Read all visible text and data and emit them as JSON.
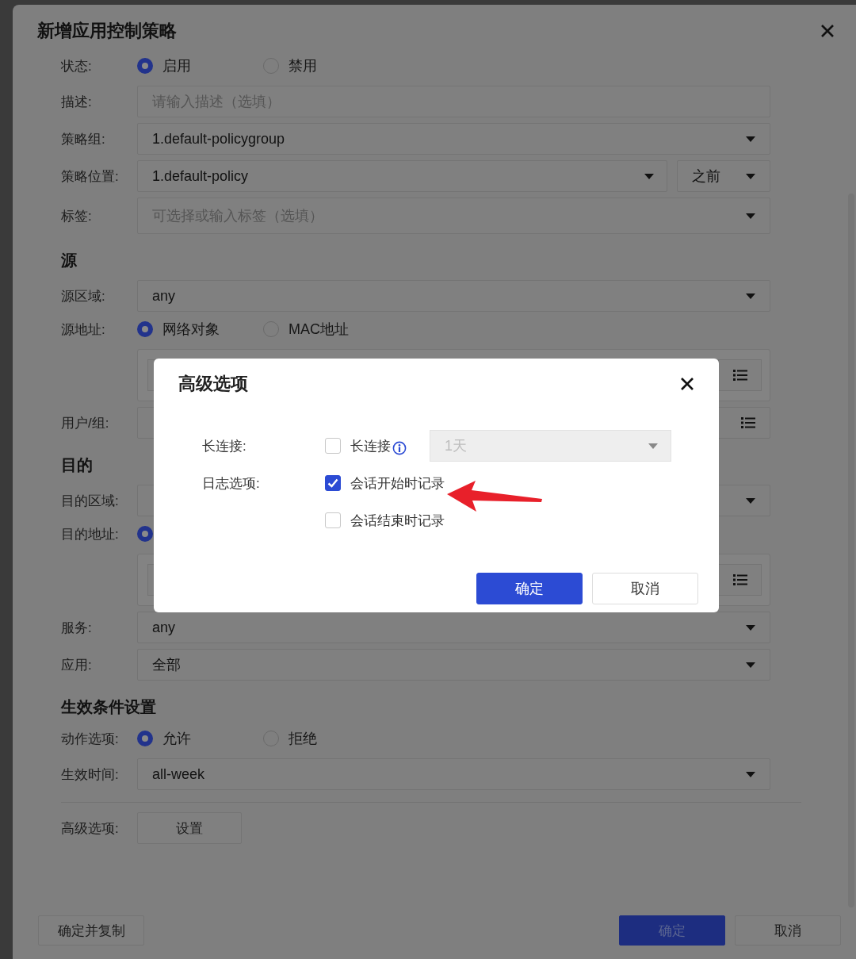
{
  "dialog": {
    "title": "新增应用控制策略",
    "rows": [
      {
        "kind": "radio",
        "label": "状态:",
        "options": [
          {
            "label": "启用",
            "selected": true
          },
          {
            "label": "禁用",
            "selected": false
          }
        ]
      },
      {
        "kind": "input",
        "label": "描述:",
        "placeholder": "请输入描述（选填）"
      },
      {
        "kind": "select",
        "label": "策略组:",
        "value": "1.default-policygroup"
      },
      {
        "kind": "select_pair",
        "label": "策略位置:",
        "value": "1.default-policy",
        "value_2": "之前"
      },
      {
        "kind": "select",
        "label": "标签:",
        "placeholder": "可选择或输入标签（选填）"
      },
      {
        "kind": "heading",
        "label": "源"
      },
      {
        "kind": "select",
        "label": "源区域:",
        "value": "any"
      },
      {
        "kind": "radio",
        "label": "源地址:",
        "options": [
          {
            "label": "网络对象",
            "selected": true
          },
          {
            "label": "MAC地址",
            "selected": false
          }
        ]
      },
      {
        "kind": "object_box"
      },
      {
        "kind": "picker",
        "label": "用户/组:"
      },
      {
        "kind": "heading",
        "label": "目的"
      },
      {
        "kind": "select",
        "label": "目的区域:"
      },
      {
        "kind": "radio",
        "label": "目的地址:",
        "options": [
          {
            "selected": true
          }
        ]
      },
      {
        "kind": "object_box"
      },
      {
        "kind": "select",
        "label": "服务:",
        "value": "any"
      },
      {
        "kind": "select",
        "label": "应用:",
        "value": "全部"
      },
      {
        "kind": "heading",
        "label": "生效条件设置"
      },
      {
        "kind": "radio",
        "label": "动作选项:",
        "options": [
          {
            "label": "允许",
            "selected": true
          },
          {
            "label": "拒绝",
            "selected": false
          }
        ]
      },
      {
        "kind": "select",
        "label": "生效时间:",
        "value": "all-week"
      },
      {
        "kind": "divider"
      },
      {
        "kind": "button",
        "label": "高级选项:",
        "button": "设置"
      }
    ],
    "footer": {
      "left": [
        {
          "label": "确定并复制",
          "kind": "default"
        }
      ],
      "right": [
        {
          "label": "确定",
          "kind": "primary"
        },
        {
          "label": "取消",
          "kind": "default"
        }
      ]
    }
  },
  "advanced_dialog": {
    "title": "高级选项",
    "rows": [
      {
        "label": "长连接:",
        "options": [
          {
            "label": "长连接",
            "checked": false,
            "info": true
          }
        ],
        "select": {
          "value": "1天",
          "disabled": true
        }
      },
      {
        "label": "日志选项:",
        "options": [
          {
            "label": "会话开始时记录",
            "checked": true
          },
          {
            "label": "会话结束时记录",
            "checked": false
          }
        ]
      }
    ],
    "buttons": [
      {
        "label": "确定",
        "kind": "primary"
      },
      {
        "label": "取消",
        "kind": "default"
      }
    ]
  }
}
